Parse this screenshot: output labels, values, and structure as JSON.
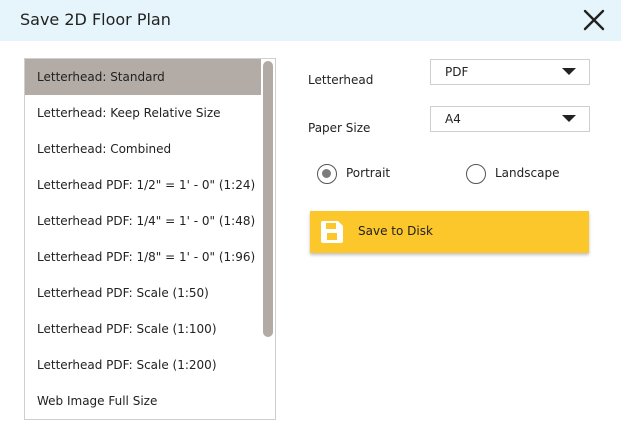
{
  "window": {
    "title": "Save 2D Floor Plan",
    "close_icon": "close-icon"
  },
  "format_list": {
    "selected_index": 0,
    "items": [
      "Letterhead: Standard",
      "Letterhead: Keep Relative Size",
      "Letterhead: Combined",
      "Letterhead PDF: 1/2\" = 1' - 0\" (1:24)",
      "Letterhead PDF: 1/4\" = 1' - 0\" (1:48)",
      "Letterhead PDF: 1/8\" = 1' - 0\" (1:96)",
      "Letterhead PDF: Scale (1:50)",
      "Letterhead PDF: Scale (1:100)",
      "Letterhead PDF: Scale (1:200)",
      "Web Image Full Size"
    ]
  },
  "letterhead": {
    "label": "Letterhead",
    "value": "PDF"
  },
  "paper_size": {
    "label": "Paper Size",
    "value": "A4"
  },
  "orientation": {
    "portrait_label": "Portrait",
    "landscape_label": "Landscape",
    "selected": "Portrait"
  },
  "save": {
    "label": "Save to Disk",
    "icon": "floppy-disk-icon"
  },
  "colors": {
    "titlebar_bg": "#e6f5fb",
    "selected_item_bg": "#b3aba5",
    "save_button_bg": "#fcc72b",
    "disk_icon_fill": "#ffffff"
  }
}
